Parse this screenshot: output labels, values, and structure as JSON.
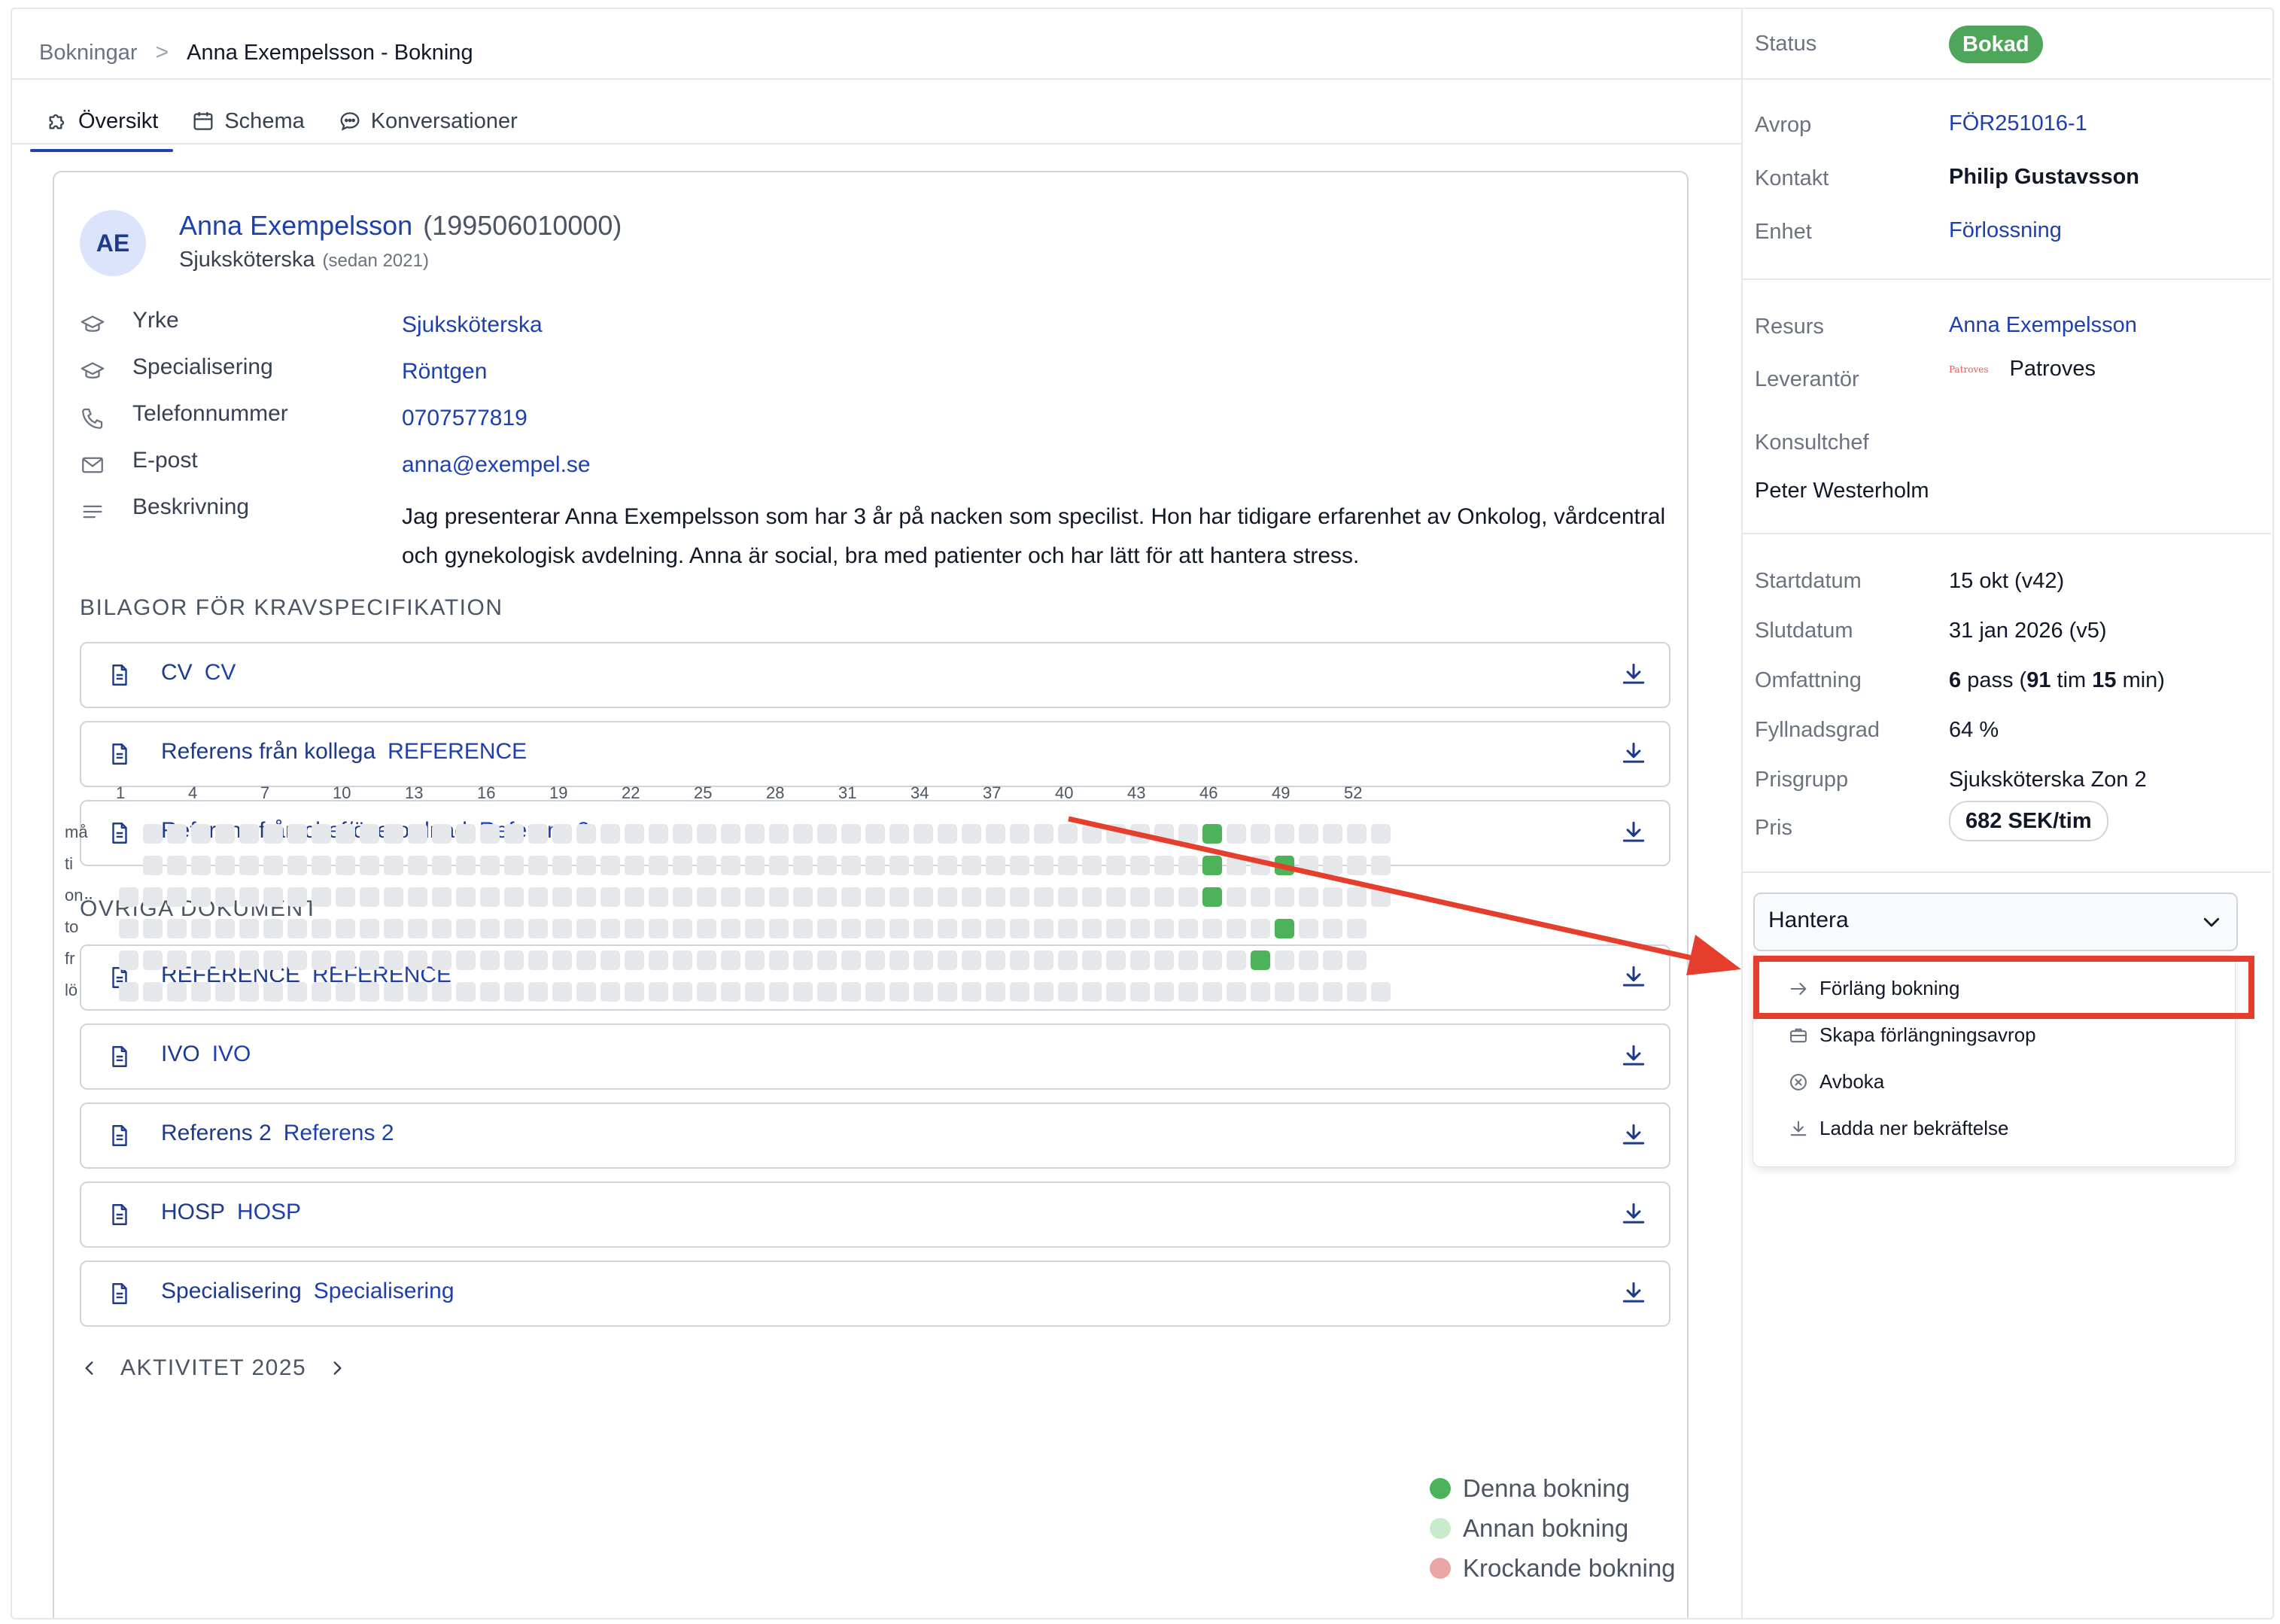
{
  "breadcrumb": {
    "parent": "Bokningar",
    "separator": ">",
    "current": "Anna Exempelsson - Bokning"
  },
  "tabs": [
    {
      "label": "Översikt",
      "icon": "puzzle-icon",
      "active": true
    },
    {
      "label": "Schema",
      "icon": "calendar-icon",
      "active": false
    },
    {
      "label": "Konversationer",
      "icon": "chat-icon",
      "active": false
    }
  ],
  "profile": {
    "initials": "AE",
    "name": "Anna Exempelsson",
    "personal_number": "(199506010000)",
    "role": "Sjuksköterska",
    "since": "(sedan 2021)",
    "fields": {
      "yrke_label": "Yrke",
      "yrke_value": "Sjuksköterska",
      "spec_label": "Specialisering",
      "spec_value": "Röntgen",
      "phone_label": "Telefonnummer",
      "phone_value": "0707577819",
      "email_label": "E-post",
      "email_value": "anna@exempel.se",
      "desc_label": "Beskrivning",
      "desc_value": "Jag presenterar Anna Exempelsson som har 3 år på nacken som specilist. Hon har tidigare erfarenhet av Onkolog, vårdcentral och gynekologisk avdelning. Anna är social, bra med patienter och har lätt för att hantera stress."
    }
  },
  "attachments": {
    "title": "BILAGOR FÖR KRAVSPECIFIKATION",
    "items": [
      {
        "name": "CV",
        "type": "CV"
      },
      {
        "name": "Referens från kollega",
        "type": "REFERENCE"
      },
      {
        "name": "Referens från chef/överordnad",
        "type": "Referens 2"
      }
    ]
  },
  "other_docs": {
    "title": "ÖVRIGA DOKUMENT",
    "items": [
      {
        "name": "REFERENCE",
        "type": "REFERENCE"
      },
      {
        "name": "IVO",
        "type": "IVO"
      },
      {
        "name": "Referens 2",
        "type": "Referens 2"
      },
      {
        "name": "HOSP",
        "type": "HOSP"
      },
      {
        "name": "Specialisering",
        "type": "Specialisering"
      }
    ]
  },
  "activity": {
    "title": "AKTIVITET 2025",
    "week_labels": [
      "1",
      "4",
      "7",
      "10",
      "13",
      "16",
      "19",
      "22",
      "25",
      "28",
      "31",
      "34",
      "37",
      "40",
      "43",
      "46",
      "49",
      "52"
    ],
    "day_labels": [
      "må",
      "ti",
      "on",
      "to",
      "fr",
      "lö"
    ],
    "weeks": 53,
    "empty_first_week_days": [
      0,
      1
    ],
    "trailing_empty_days": [
      3,
      4
    ],
    "booked_cells": [
      {
        "week": 46,
        "day": 0
      },
      {
        "week": 46,
        "day": 1
      },
      {
        "week": 46,
        "day": 2
      },
      {
        "week": 49,
        "day": 1
      },
      {
        "week": 49,
        "day": 3
      },
      {
        "week": 48,
        "day": 4
      }
    ],
    "legend": [
      {
        "label": "Denna bokning",
        "color": "#4db35a"
      },
      {
        "label": "Annan bokning",
        "color": "#c8eccb"
      },
      {
        "label": "Krockande bokning",
        "color": "#eaa5a5"
      }
    ],
    "colors": {
      "empty": "#e5e7eb",
      "this_booking": "#4db35a"
    }
  },
  "side": {
    "status_label": "Status",
    "status_value": "Bokad",
    "avrop_label": "Avrop",
    "avrop_value": "FÖR251016-1",
    "kontakt_label": "Kontakt",
    "kontakt_value": "Philip Gustavsson",
    "enhet_label": "Enhet",
    "enhet_value": "Förlossning",
    "resurs_label": "Resurs",
    "resurs_value": "Anna Exempelsson",
    "leverantor_label": "Leverantör",
    "leverantor_logo": "Patroves",
    "leverantor_value": "Patroves",
    "konsultchef_label": "Konsultchef",
    "konsultchef_value": "Peter Westerholm",
    "startdatum_label": "Startdatum",
    "startdatum_value": "15 okt (v42)",
    "slutdatum_label": "Slutdatum",
    "slutdatum_value": "31 jan 2026 (v5)",
    "omfattning_label": "Omfattning",
    "omfattning": {
      "pass_count": "6",
      "pass_text": "pass (",
      "hours": "91",
      "hours_text": "tim",
      "minutes": "15",
      "minutes_text": "min)"
    },
    "fyllnadsgrad_label": "Fyllnadsgrad",
    "fyllnadsgrad_value": "64 %",
    "prisgrupp_label": "Prisgrupp",
    "prisgrupp_value": "Sjuksköterska Zon 2",
    "pris_label": "Pris",
    "pris_value": "682 SEK/tim"
  },
  "manage": {
    "select_label": "Hantera",
    "options": [
      {
        "label": "Förläng bokning",
        "icon": "arrow-right-icon"
      },
      {
        "label": "Skapa förlängningsavrop",
        "icon": "briefcase-icon"
      },
      {
        "label": "Avboka",
        "icon": "x-circle-icon"
      },
      {
        "label": "Ladda ner bekräftelse",
        "icon": "download-icon"
      }
    ]
  },
  "colors": {
    "accent": "#1e40af",
    "status_green": "#4ea65a",
    "annotation_red": "#e53e2c"
  }
}
